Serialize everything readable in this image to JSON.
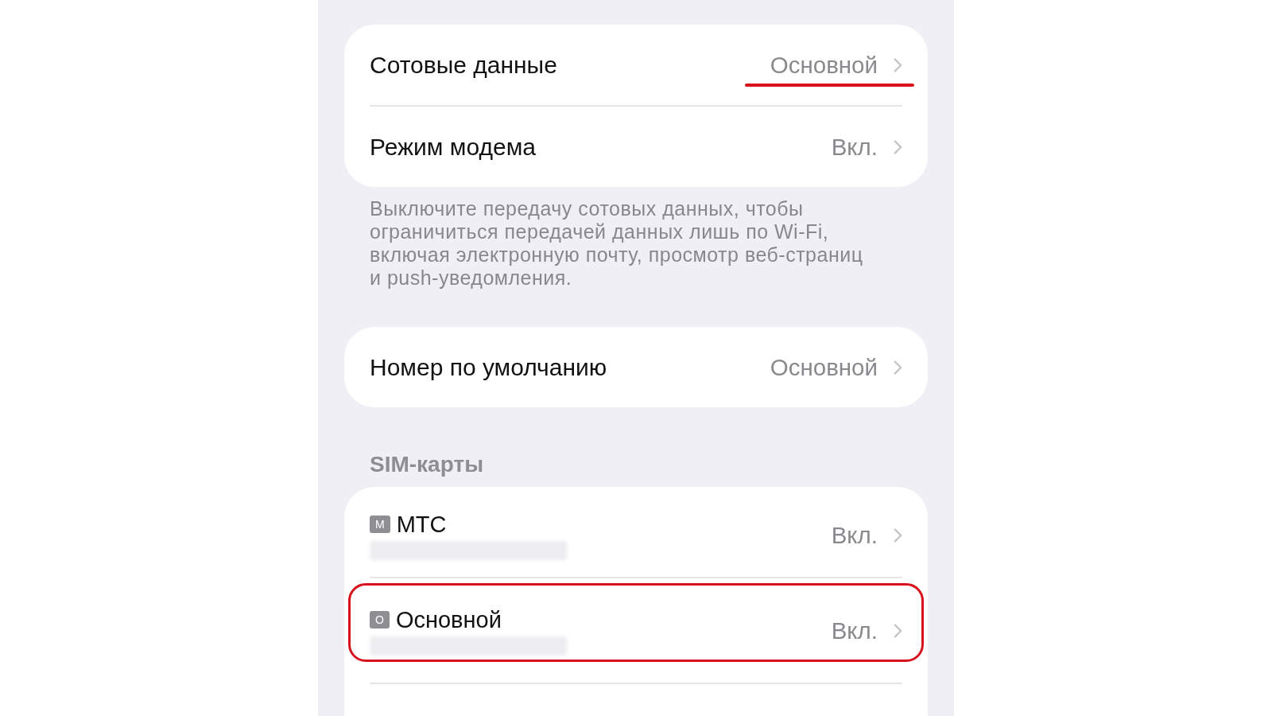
{
  "sections": [
    {
      "rows": [
        {
          "kind": "setting",
          "label": "Сотовые данные",
          "value": "Основной",
          "underlined": true
        },
        {
          "kind": "setting",
          "label": "Режим модема",
          "value": "Вкл.",
          "underlined": false
        }
      ],
      "footer": "Выключите передачу сотовых данных, чтобы ограничиться передачей данных лишь по Wi-Fi, включая электронную почту, просмотр веб-страниц и push-уведомления."
    },
    {
      "rows": [
        {
          "kind": "setting",
          "label": "Номер по умолчанию",
          "value": "Основной",
          "underlined": false
        }
      ]
    },
    {
      "header": "SIM-карты",
      "rows": [
        {
          "kind": "sim",
          "badge": "М",
          "label": "МТС",
          "value": "Вкл.",
          "outlined": false
        },
        {
          "kind": "sim",
          "badge": "О",
          "label": "Основной",
          "value": "Вкл.",
          "outlined": true
        }
      ],
      "cut_off": true
    }
  ]
}
